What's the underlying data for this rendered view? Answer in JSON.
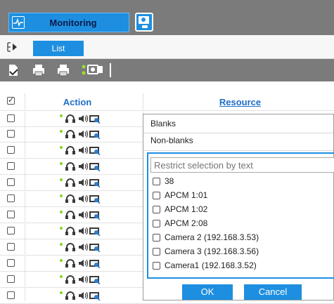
{
  "header": {
    "module_tab": "Monitoring"
  },
  "subnav": {
    "list_tab": "List"
  },
  "toolbar": {
    "buttons": [
      "export-icon",
      "batch-print-icon",
      "batch-print-alt-icon",
      "settings-icon"
    ]
  },
  "table": {
    "columns": {
      "action": "Action",
      "resource": "Resource"
    },
    "row_actions": [
      "status-dot-icon",
      "headset-icon",
      "speaker-icon",
      "camera-icon"
    ]
  },
  "filter_dropdown": {
    "blanks": "Blanks",
    "non_blanks": "Non-blanks",
    "placeholder": "Restrict selection by text",
    "options": [
      "38",
      "APCM 1:01",
      "APCM 1:02",
      "APCM 2:08",
      "Camera 2 (192.168.3.53)",
      "Camera 3 (192.168.3.56)",
      "Camera1 (192.168.3.52)"
    ],
    "ok": "OK",
    "cancel": "Cancel"
  },
  "colors": {
    "accent": "#1e8fe0",
    "bar": "#7b7b7b",
    "header_text": "#1e6ec8"
  }
}
